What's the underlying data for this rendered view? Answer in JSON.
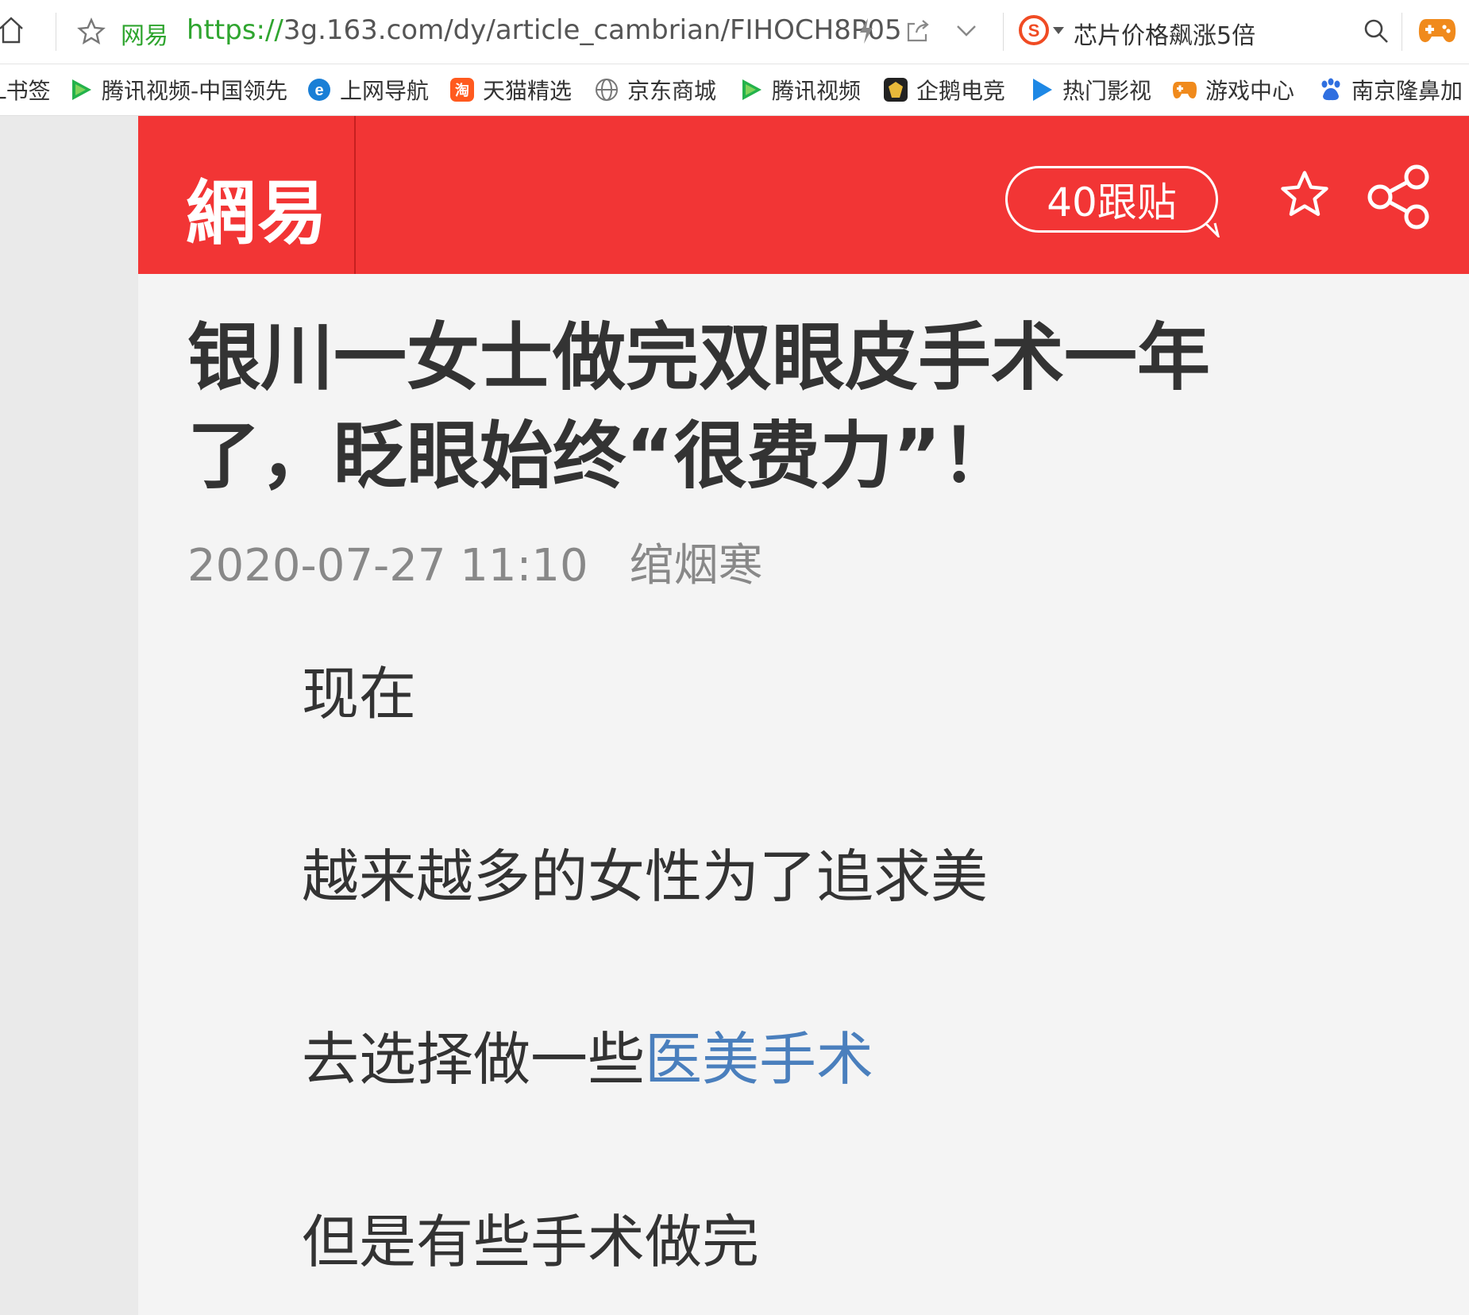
{
  "browser": {
    "site_label": "网易",
    "url_scheme": "https://",
    "url_rest": "3g.163.com/dy/article_cambrian/FIHOCH8P05",
    "search_text": "芯片价格飙涨5倍"
  },
  "bookmarks": [
    {
      "label": "L书签",
      "icon": "bookmark-icon",
      "color": "#e9a23b"
    },
    {
      "label": "腾讯视频-中国领先",
      "icon": "tencent-video-icon",
      "color": "#23b24b"
    },
    {
      "label": "上网导航",
      "icon": "ie-icon",
      "color": "#1a7fd6"
    },
    {
      "label": "天猫精选",
      "icon": "taobao-icon",
      "color": "#ff5a1f"
    },
    {
      "label": "京东商城",
      "icon": "globe-icon",
      "color": "#777777"
    },
    {
      "label": "腾讯视频",
      "icon": "tencent-video-icon",
      "color": "#23b24b"
    },
    {
      "label": "企鹅电竞",
      "icon": "penguin-esports-icon",
      "color": "#222222"
    },
    {
      "label": "热门影视",
      "icon": "video-play-icon",
      "color": "#1e88e5"
    },
    {
      "label": "游戏中心",
      "icon": "gamepad-icon",
      "color": "#f08a1c"
    },
    {
      "label": "南京隆鼻加",
      "icon": "baidu-paw-icon",
      "color": "#2f6fe0"
    }
  ],
  "header": {
    "logo": "網易",
    "comment_count": "40跟贴",
    "bg_color": "#f23535"
  },
  "article": {
    "title": "银川一女士做完双眼皮手术一年了，眨眼始终“很费力”！",
    "date": "2020-07-27 11:10",
    "author": "绾烟寒",
    "paragraphs": [
      {
        "text": "现在"
      },
      {
        "text": "越来越多的女性为了追求美"
      },
      {
        "text": "去选择做一些",
        "link": "医美手术"
      },
      {
        "text": "但是有些手术做完"
      }
    ],
    "link_color": "#4a7fbd"
  }
}
